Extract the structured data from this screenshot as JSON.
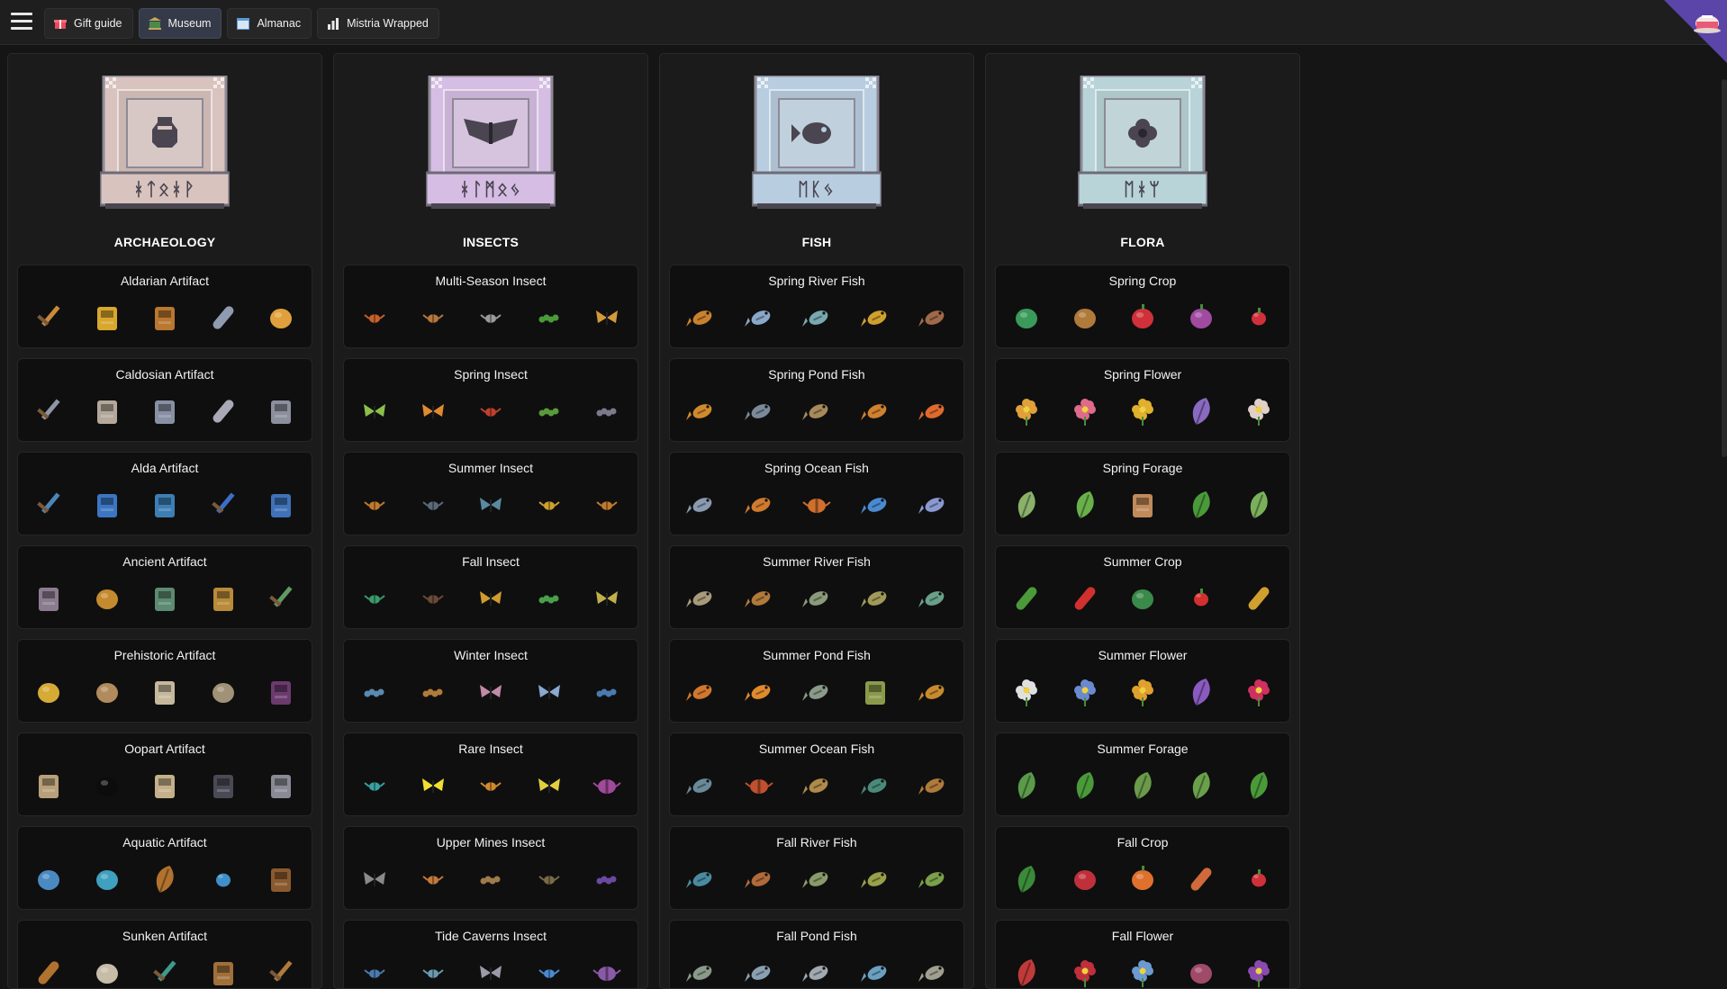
{
  "topbar": {
    "tabs": [
      {
        "label": "Gift guide",
        "icon": "gift-icon",
        "active": false
      },
      {
        "label": "Museum",
        "icon": "museum-icon",
        "active": true
      },
      {
        "label": "Almanac",
        "icon": "calendar-icon",
        "active": false
      },
      {
        "label": "Mistria Wrapped",
        "icon": "chart-icon",
        "active": false
      }
    ],
    "avatar_icon": "teacup-icon"
  },
  "colors": {
    "background": "#151515",
    "topbar": "#1e1e1e",
    "active_tab": "#353a48",
    "card": "#0f0f0f",
    "corner_accent": "#5b45a8"
  },
  "columns": [
    {
      "title": "ARCHAEOLOGY",
      "plaque_icon": "vase-icon",
      "plaque_runes": "ᚼᛏᛟᚼᚹ",
      "plaque_color": "#d9c3be",
      "cards": [
        {
          "title": "Aldarian Artifact",
          "items": [
            {
              "icon": "sword-icon",
              "color": "#c98a3a"
            },
            {
              "icon": "amulet-icon",
              "color": "#d8a72e"
            },
            {
              "icon": "totem-icon",
              "color": "#b9772f"
            },
            {
              "icon": "horn-icon",
              "color": "#8f9bb0"
            },
            {
              "icon": "ring-icon",
              "color": "#e0a13c"
            }
          ]
        },
        {
          "title": "Caldosian Artifact",
          "items": [
            {
              "icon": "sword-icon",
              "color": "#8e97a6"
            },
            {
              "icon": "bust-icon",
              "color": "#b4a89a"
            },
            {
              "icon": "armor-icon",
              "color": "#8791a3"
            },
            {
              "icon": "boot-icon",
              "color": "#a9a9b5"
            },
            {
              "icon": "helmet-icon",
              "color": "#8c8f9c"
            }
          ]
        },
        {
          "title": "Alda Artifact",
          "items": [
            {
              "icon": "sword-icon",
              "color": "#4b86b6"
            },
            {
              "icon": "potion-icon",
              "color": "#3c76c2"
            },
            {
              "icon": "amulet-icon",
              "color": "#3d7fb4"
            },
            {
              "icon": "bow-icon",
              "color": "#3c6ec9"
            },
            {
              "icon": "tablet-icon",
              "color": "#3f72b8"
            }
          ]
        },
        {
          "title": "Ancient Artifact",
          "items": [
            {
              "icon": "lantern-icon",
              "color": "#8a7c8e"
            },
            {
              "icon": "coin-icon",
              "color": "#c48a2e"
            },
            {
              "icon": "cup-icon",
              "color": "#5d8a72"
            },
            {
              "icon": "mask-icon",
              "color": "#b88a3a"
            },
            {
              "icon": "pickaxe-icon",
              "color": "#5f9a62"
            }
          ]
        },
        {
          "title": "Prehistoric Artifact",
          "items": [
            {
              "icon": "shell-icon",
              "color": "#d6ab35"
            },
            {
              "icon": "fossil-icon",
              "color": "#b28b5c"
            },
            {
              "icon": "skeleton-icon",
              "color": "#c6b89c"
            },
            {
              "icon": "stone-icon",
              "color": "#a09276"
            },
            {
              "icon": "claw-icon",
              "color": "#6b3a6e"
            }
          ]
        },
        {
          "title": "Oopart Artifact",
          "items": [
            {
              "icon": "frame-icon",
              "color": "#b8a07a"
            },
            {
              "icon": "orb-icon",
              "color": "#0c0c0c"
            },
            {
              "icon": "scroll-icon",
              "color": "#c4b08a"
            },
            {
              "icon": "keyboard-icon",
              "color": "#4a4a56"
            },
            {
              "icon": "robot-icon",
              "color": "#8a8a96"
            }
          ]
        },
        {
          "title": "Aquatic Artifact",
          "items": [
            {
              "icon": "rock-icon",
              "color": "#4a8ac0"
            },
            {
              "icon": "shell-icon",
              "color": "#3fa0c0"
            },
            {
              "icon": "coral-icon",
              "color": "#b0722e"
            },
            {
              "icon": "pearl-icon",
              "color": "#3f8fc9"
            },
            {
              "icon": "chest-icon",
              "color": "#8a5a2e"
            }
          ]
        },
        {
          "title": "Sunken Artifact",
          "items": [
            {
              "icon": "bottle-icon",
              "color": "#b0722e"
            },
            {
              "icon": "gear-icon",
              "color": "#c6bca8"
            },
            {
              "icon": "trident-icon",
              "color": "#3f9a8a"
            },
            {
              "icon": "map-icon",
              "color": "#a0703a"
            },
            {
              "icon": "wand-icon",
              "color": "#b07a3a"
            }
          ]
        }
      ]
    },
    {
      "title": "INSECTS",
      "plaque_icon": "moth-icon",
      "plaque_runes": "ᚼᛚᛗᛟᛃ",
      "plaque_color": "#d6bde3",
      "cards": [
        {
          "title": "Multi-Season Insect",
          "items": [
            {
              "icon": "ladybug-icon",
              "color": "#c8602a"
            },
            {
              "icon": "beetle-icon",
              "color": "#b5773a"
            },
            {
              "icon": "cicada-icon",
              "color": "#9a9a9a"
            },
            {
              "icon": "caterpillar-icon",
              "color": "#4a9a3a"
            },
            {
              "icon": "moth-icon",
              "color": "#d39a3a"
            }
          ]
        },
        {
          "title": "Spring Insect",
          "items": [
            {
              "icon": "butterfly-icon",
              "color": "#8ac04a"
            },
            {
              "icon": "butterfly-icon",
              "color": "#e08a2e"
            },
            {
              "icon": "ladybug-icon",
              "color": "#c0402e"
            },
            {
              "icon": "caterpillar-icon",
              "color": "#5a9a3a"
            },
            {
              "icon": "snail-icon",
              "color": "#7a7a8a"
            }
          ]
        },
        {
          "title": "Summer Insect",
          "items": [
            {
              "icon": "beetle-icon",
              "color": "#c07a2e"
            },
            {
              "icon": "ant-icon",
              "color": "#5a6a7a"
            },
            {
              "icon": "dragonfly-icon",
              "color": "#5a8aa0"
            },
            {
              "icon": "bee-icon",
              "color": "#d0a02e"
            },
            {
              "icon": "beetle-icon",
              "color": "#c07a2e"
            }
          ]
        },
        {
          "title": "Fall Insect",
          "items": [
            {
              "icon": "beetle-icon",
              "color": "#3a9a6a"
            },
            {
              "icon": "ant-icon",
              "color": "#6a4a3a"
            },
            {
              "icon": "butterfly-icon",
              "color": "#d09a2e"
            },
            {
              "icon": "caterpillar-icon",
              "color": "#4aa04a"
            },
            {
              "icon": "butterfly-icon",
              "color": "#c0b04a"
            }
          ]
        },
        {
          "title": "Winter Insect",
          "items": [
            {
              "icon": "worm-icon",
              "color": "#5a8ab0"
            },
            {
              "icon": "stick-icon",
              "color": "#b07a3a"
            },
            {
              "icon": "moth-icon",
              "color": "#c08aa8"
            },
            {
              "icon": "butterfly-icon",
              "color": "#8aa8d0"
            },
            {
              "icon": "slug-icon",
              "color": "#4a7ab0"
            }
          ]
        },
        {
          "title": "Rare Insect",
          "items": [
            {
              "icon": "firefly-icon",
              "color": "#3aa0a0"
            },
            {
              "icon": "dragonfly-icon",
              "color": "#f0e030"
            },
            {
              "icon": "beetle-icon",
              "color": "#d08a2e"
            },
            {
              "icon": "moth-icon",
              "color": "#e0d040"
            },
            {
              "icon": "spider-icon",
              "color": "#a04a9a"
            }
          ]
        },
        {
          "title": "Upper Mines Insect",
          "items": [
            {
              "icon": "moth-icon",
              "color": "#8a8a8a"
            },
            {
              "icon": "beetle-icon",
              "color": "#c07a3a"
            },
            {
              "icon": "worm-icon",
              "color": "#a07a4a"
            },
            {
              "icon": "ant-icon",
              "color": "#7a6a4a"
            },
            {
              "icon": "snail-icon",
              "color": "#6a4aa0"
            }
          ]
        },
        {
          "title": "Tide Caverns Insect",
          "items": [
            {
              "icon": "beetle-icon",
              "color": "#4a7ab0"
            },
            {
              "icon": "beetle-icon",
              "color": "#6a9ab0"
            },
            {
              "icon": "moth-icon",
              "color": "#9a9aa8"
            },
            {
              "icon": "beetle-icon",
              "color": "#4a8ad0"
            },
            {
              "icon": "spider-icon",
              "color": "#8a5aa8"
            }
          ]
        }
      ]
    },
    {
      "title": "FISH",
      "plaque_icon": "fish-icon",
      "plaque_runes": "ᛖᛕᛃ",
      "plaque_color": "#b8cde0",
      "cards": [
        {
          "title": "Spring River Fish",
          "items": [
            {
              "icon": "fish-icon",
              "color": "#c8822e"
            },
            {
              "icon": "fish-icon",
              "color": "#8aa8c8"
            },
            {
              "icon": "fish-icon",
              "color": "#7aa8b0"
            },
            {
              "icon": "fish-icon",
              "color": "#d0a02e"
            },
            {
              "icon": "fish-icon",
              "color": "#a06a4a"
            }
          ]
        },
        {
          "title": "Spring Pond Fish",
          "items": [
            {
              "icon": "fish-icon",
              "color": "#d08a2e"
            },
            {
              "icon": "fish-icon",
              "color": "#7a8a9a"
            },
            {
              "icon": "fish-icon",
              "color": "#a88a5a"
            },
            {
              "icon": "fish-icon",
              "color": "#d0802e"
            },
            {
              "icon": "fish-icon",
              "color": "#e06a2e"
            }
          ]
        },
        {
          "title": "Spring Ocean Fish",
          "items": [
            {
              "icon": "fish-icon",
              "color": "#8a9ab0"
            },
            {
              "icon": "shrimp-icon",
              "color": "#d07a2e"
            },
            {
              "icon": "crab-icon",
              "color": "#d0702e"
            },
            {
              "icon": "fish-icon",
              "color": "#4a8ad0"
            },
            {
              "icon": "whale-icon",
              "color": "#8a9ad0"
            }
          ]
        },
        {
          "title": "Summer River Fish",
          "items": [
            {
              "icon": "fish-icon",
              "color": "#a89a7a"
            },
            {
              "icon": "eel-icon",
              "color": "#b07a3a"
            },
            {
              "icon": "fish-icon",
              "color": "#8a9a7a"
            },
            {
              "icon": "fish-icon",
              "color": "#a09a5a"
            },
            {
              "icon": "fish-icon",
              "color": "#6aa08a"
            }
          ]
        },
        {
          "title": "Summer Pond Fish",
          "items": [
            {
              "icon": "fish-icon",
              "color": "#d0782e"
            },
            {
              "icon": "fish-icon",
              "color": "#e08a2e"
            },
            {
              "icon": "fish-icon",
              "color": "#8a9a8a"
            },
            {
              "icon": "frog-icon",
              "color": "#8a9a4a"
            },
            {
              "icon": "fish-icon",
              "color": "#c88a2e"
            }
          ]
        },
        {
          "title": "Summer Ocean Fish",
          "items": [
            {
              "icon": "fish-icon",
              "color": "#6a8a9a"
            },
            {
              "icon": "crab-icon",
              "color": "#c0502e"
            },
            {
              "icon": "ray-icon",
              "color": "#b08a4a"
            },
            {
              "icon": "fish-icon",
              "color": "#4a8a7a"
            },
            {
              "icon": "fish-icon",
              "color": "#b07a3a"
            }
          ]
        },
        {
          "title": "Fall River Fish",
          "items": [
            {
              "icon": "fish-icon",
              "color": "#4a8aa0"
            },
            {
              "icon": "eel-icon",
              "color": "#b06a3a"
            },
            {
              "icon": "fish-icon",
              "color": "#8a9a6a"
            },
            {
              "icon": "fish-icon",
              "color": "#9aa04a"
            },
            {
              "icon": "fish-icon",
              "color": "#7aa04a"
            }
          ]
        },
        {
          "title": "Fall Pond Fish",
          "items": [
            {
              "icon": "fish-icon",
              "color": "#8a9a8a"
            },
            {
              "icon": "fish-icon",
              "color": "#8aa0b0"
            },
            {
              "icon": "fish-icon",
              "color": "#a0a8b0"
            },
            {
              "icon": "fish-icon",
              "color": "#6aa0c0"
            },
            {
              "icon": "fish-icon",
              "color": "#a0a090"
            }
          ]
        }
      ]
    },
    {
      "title": "FLORA",
      "plaque_icon": "flower-icon",
      "plaque_runes": "ᛖᚼᛘ",
      "plaque_color": "#b8d4d8",
      "cards": [
        {
          "title": "Spring Crop",
          "items": [
            {
              "icon": "cabbage-icon",
              "color": "#3a9a5a"
            },
            {
              "icon": "potato-icon",
              "color": "#b07a3a"
            },
            {
              "icon": "strawberry-icon",
              "color": "#d0303a"
            },
            {
              "icon": "turnip-icon",
              "color": "#a04aa0"
            },
            {
              "icon": "cherry-icon",
              "color": "#d0303a"
            }
          ]
        },
        {
          "title": "Spring Flower",
          "items": [
            {
              "icon": "flower-icon",
              "color": "#e0a03a"
            },
            {
              "icon": "tulip-icon",
              "color": "#e06a8a"
            },
            {
              "icon": "flower-icon",
              "color": "#e0b02e"
            },
            {
              "icon": "lavender-icon",
              "color": "#8a6ac0"
            },
            {
              "icon": "flower-icon",
              "color": "#e0d0c8"
            }
          ]
        },
        {
          "title": "Spring Forage",
          "items": [
            {
              "icon": "herb-icon",
              "color": "#8ab06a"
            },
            {
              "icon": "fern-icon",
              "color": "#6ab04a"
            },
            {
              "icon": "mushroom-icon",
              "color": "#c08a5a"
            },
            {
              "icon": "leaf-icon",
              "color": "#4a9a3a"
            },
            {
              "icon": "sprout-icon",
              "color": "#7ab05a"
            }
          ]
        },
        {
          "title": "Summer Crop",
          "items": [
            {
              "icon": "cucumber-icon",
              "color": "#4a9a3a"
            },
            {
              "icon": "pepper-icon",
              "color": "#d0302e"
            },
            {
              "icon": "melon-icon",
              "color": "#3a8a4a"
            },
            {
              "icon": "tomato-icon",
              "color": "#d0302e"
            },
            {
              "icon": "corn-icon",
              "color": "#d0a02e"
            }
          ]
        },
        {
          "title": "Summer Flower",
          "items": [
            {
              "icon": "flower-icon",
              "color": "#e0e0e0"
            },
            {
              "icon": "flower-icon",
              "color": "#6a8ad0"
            },
            {
              "icon": "sunflower-icon",
              "color": "#e0a02e"
            },
            {
              "icon": "lavender-icon",
              "color": "#8a5ac0"
            },
            {
              "icon": "flower-icon",
              "color": "#d03060"
            }
          ]
        },
        {
          "title": "Summer Forage",
          "items": [
            {
              "icon": "leaf-icon",
              "color": "#5a9a4a"
            },
            {
              "icon": "leaf-icon",
              "color": "#4a9a3a"
            },
            {
              "icon": "herb-icon",
              "color": "#6a9a4a"
            },
            {
              "icon": "sprout-icon",
              "color": "#6aa04a"
            },
            {
              "icon": "fern-icon",
              "color": "#4a9a3a"
            }
          ]
        },
        {
          "title": "Fall Crop",
          "items": [
            {
              "icon": "broccoli-icon",
              "color": "#3a8a3a"
            },
            {
              "icon": "berry-icon",
              "color": "#c0303a"
            },
            {
              "icon": "pumpkin-icon",
              "color": "#e0702e"
            },
            {
              "icon": "sweet-potato-icon",
              "color": "#d06a3a"
            },
            {
              "icon": "apple-icon",
              "color": "#d0303a"
            }
          ]
        },
        {
          "title": "Fall Flower",
          "items": [
            {
              "icon": "coral-icon",
              "color": "#c03a3a"
            },
            {
              "icon": "rose-icon",
              "color": "#c0303a"
            },
            {
              "icon": "flower-icon",
              "color": "#6a9ad0"
            },
            {
              "icon": "berry-icon",
              "color": "#a04a6a"
            },
            {
              "icon": "pansy-icon",
              "color": "#8a4ab0"
            }
          ]
        }
      ]
    }
  ]
}
